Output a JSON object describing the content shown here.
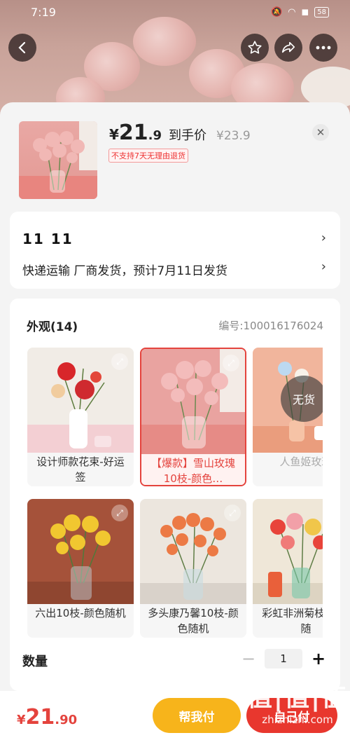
{
  "status": {
    "time": "7:19",
    "battery": "58"
  },
  "header": {
    "back": "back-icon",
    "favorite": "star-icon",
    "share": "share-icon",
    "more": "more-icon"
  },
  "product": {
    "currency": "¥",
    "price_int": "21",
    "price_dec": ".9",
    "price_label": "到手价",
    "original_price": "¥23.9",
    "no_return": "不支持7天无理由退货"
  },
  "delivery": {
    "date": "11  11",
    "text": "快递运输 厂商发货，预计7月11日发货"
  },
  "spec": {
    "title": "外观(14)",
    "code": "编号:100016176024",
    "options": [
      {
        "label": "设计师款花束-好运签",
        "state": "normal"
      },
      {
        "label": "【爆款】雪山玫瑰10枝-颜色…",
        "state": "selected"
      },
      {
        "label": "人鱼姬玫瑰",
        "state": "disabled",
        "badge": "无货"
      },
      {
        "label": "六出10枝-颜色随机",
        "state": "normal"
      },
      {
        "label": "多头康乃馨10枝-颜色随机",
        "state": "normal"
      },
      {
        "label": "彩虹非洲菊枝-三色随",
        "state": "normal"
      }
    ]
  },
  "quantity": {
    "label": "数量",
    "minus": "−",
    "value": "1",
    "plus": "+"
  },
  "bottom": {
    "currency": "¥",
    "price_int": "21",
    "price_dec": ".90",
    "help_pay": "帮我付",
    "self_pay": "自己付"
  },
  "watermark": {
    "big": "值|值|值",
    "small": "zhizhizhi.com"
  },
  "colors": {
    "accent": "#e4433d",
    "help_button": "#f7b41b",
    "self_button": "#e8372e"
  }
}
